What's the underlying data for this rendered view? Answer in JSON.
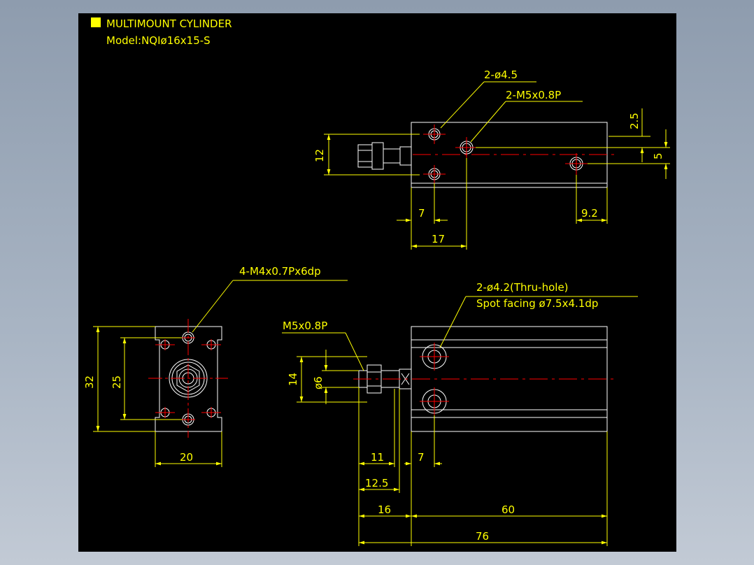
{
  "title": {
    "line1": "MULTIMOUNT CYLINDER",
    "line2": "Model:NQIø16x15-S",
    "marker_color": "#ffff00"
  },
  "top_view": {
    "callouts": [
      "2-ø4.5",
      "2-M5x0.8P"
    ],
    "dims": {
      "height": "12",
      "offset_top": "2.5",
      "spacing": "5",
      "left_hole": "7",
      "right_hole": "9.2",
      "port": "17"
    }
  },
  "end_view": {
    "callout": "4-M4x0.7Px6dp",
    "dims": {
      "height": "32",
      "pitch": "25",
      "width": "20"
    }
  },
  "side_view": {
    "callout_thread": "M5x0.8P",
    "callout_hole_1": "2-ø4.2(Thru-hole)",
    "callout_hole_2": "Spot facing ø7.5x4.1dp",
    "dims": {
      "rod_height": "14",
      "rod_dia": "ø6",
      "thread": "11",
      "rod_len": "12.5",
      "hole_pos": "7",
      "rod_ext": "16",
      "body": "60",
      "total": "76"
    }
  },
  "colors": {
    "background": "#000000",
    "outline": "#ffffff",
    "dimension": "#ffff00",
    "centerline": "#ff0000"
  }
}
